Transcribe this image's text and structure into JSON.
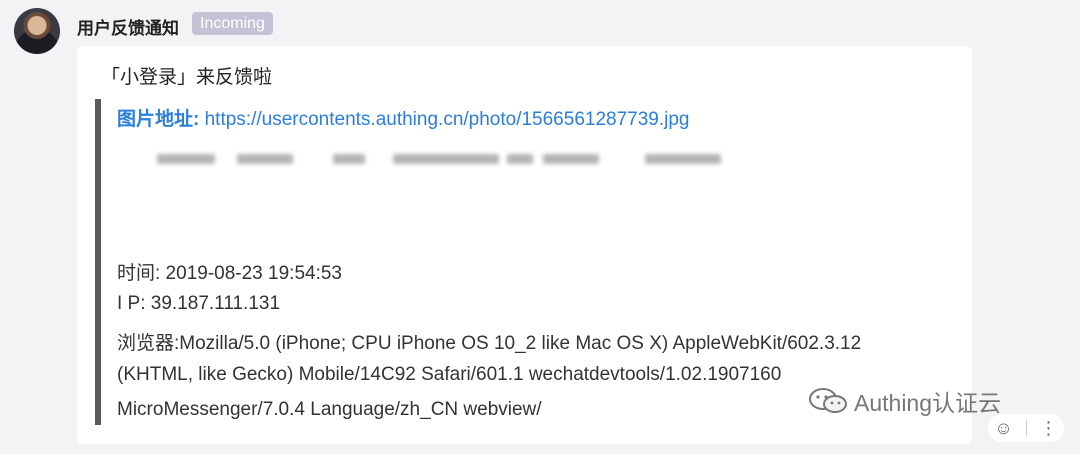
{
  "message": {
    "sender": "用户反馈通知",
    "badge": "Incoming"
  },
  "card": {
    "headline": "「小登录」来反馈啦",
    "image_label": "图片地址:",
    "image_url": "https://usercontents.authing.cn/photo/1566561287739.jpg",
    "time_line": "时间: 2019-08-23 19:54:53",
    "ip_line": "I P: 39.187.111.131",
    "ua_line1": "浏览器:Mozilla/5.0 (iPhone; CPU iPhone OS 10_2 like Mac OS X) AppleWebKit/602.3.12",
    "ua_line2": "(KHTML, like Gecko) Mobile/14C92 Safari/601.1 wechatdevtools/1.02.1907160",
    "ua_line3": "MicroMessenger/7.0.4 Language/zh_CN webview/"
  },
  "watermark": {
    "text": "Authing认证云",
    "icon": "wechat-icon"
  },
  "toolbar": {
    "emoji_icon": "emoji-icon",
    "more_icon": "more-icon",
    "emoji_glyph": "☺",
    "more_glyph": "⋮"
  }
}
